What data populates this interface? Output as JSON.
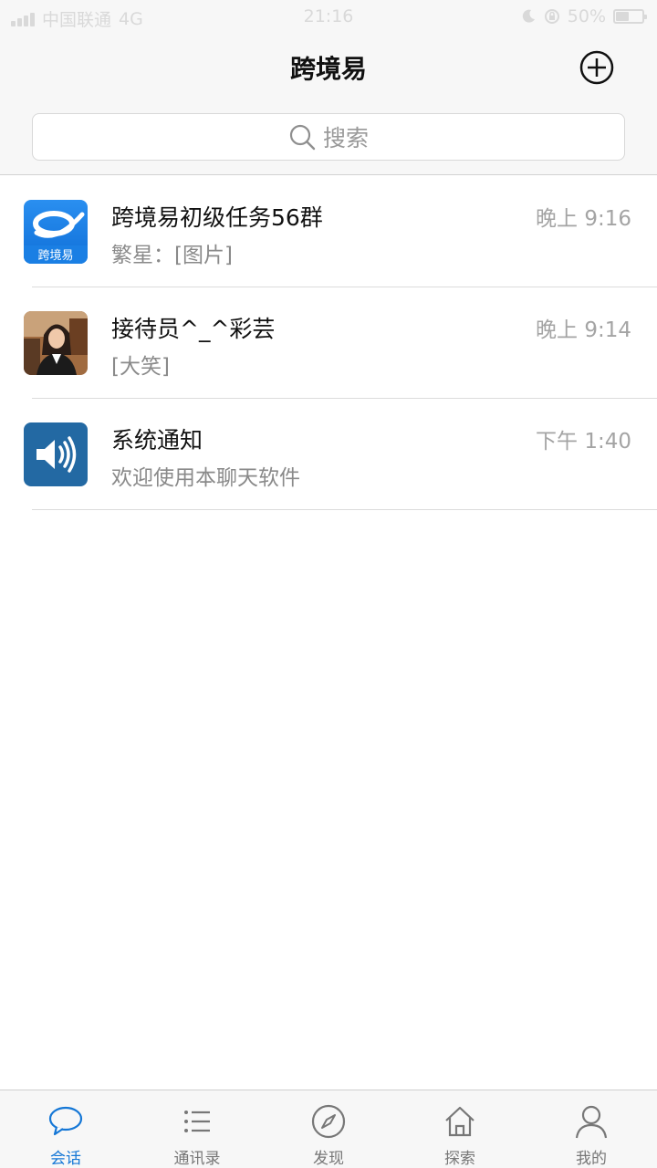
{
  "status_bar": {
    "carrier": "中国联通",
    "network": "4G",
    "time": "21:16",
    "battery": "50%",
    "battery_level": 0.5
  },
  "header": {
    "title": "跨境易",
    "add_icon": "plus-circle-icon",
    "search_placeholder": "搜索",
    "search_icon": "search-icon"
  },
  "conversations": [
    {
      "title": "跨境易初级任务56群",
      "preview": "繁星：[图片]",
      "time": "晚上 9:16",
      "avatar": "app-logo",
      "avatar_caption": "跨境易"
    },
    {
      "title": "接待员^_^彩芸",
      "preview": "[大笑]",
      "time": "晚上 9:14",
      "avatar": "user-photo"
    },
    {
      "title": "系统通知",
      "preview": "欢迎使用本聊天软件",
      "time": "下午 1:40",
      "avatar": "speaker-icon"
    }
  ],
  "tabbar": {
    "tabs": [
      {
        "label": "会话",
        "icon": "chat-bubble-icon",
        "active": true
      },
      {
        "label": "通讯录",
        "icon": "list-icon",
        "active": false
      },
      {
        "label": "发现",
        "icon": "compass-icon",
        "active": false
      },
      {
        "label": "探索",
        "icon": "home-icon",
        "active": false
      },
      {
        "label": "我的",
        "icon": "person-icon",
        "active": false
      }
    ]
  },
  "colors": {
    "accent": "#1577d6",
    "bar_background": "#f7f7f7",
    "muted_text": "#8a8a8a"
  }
}
